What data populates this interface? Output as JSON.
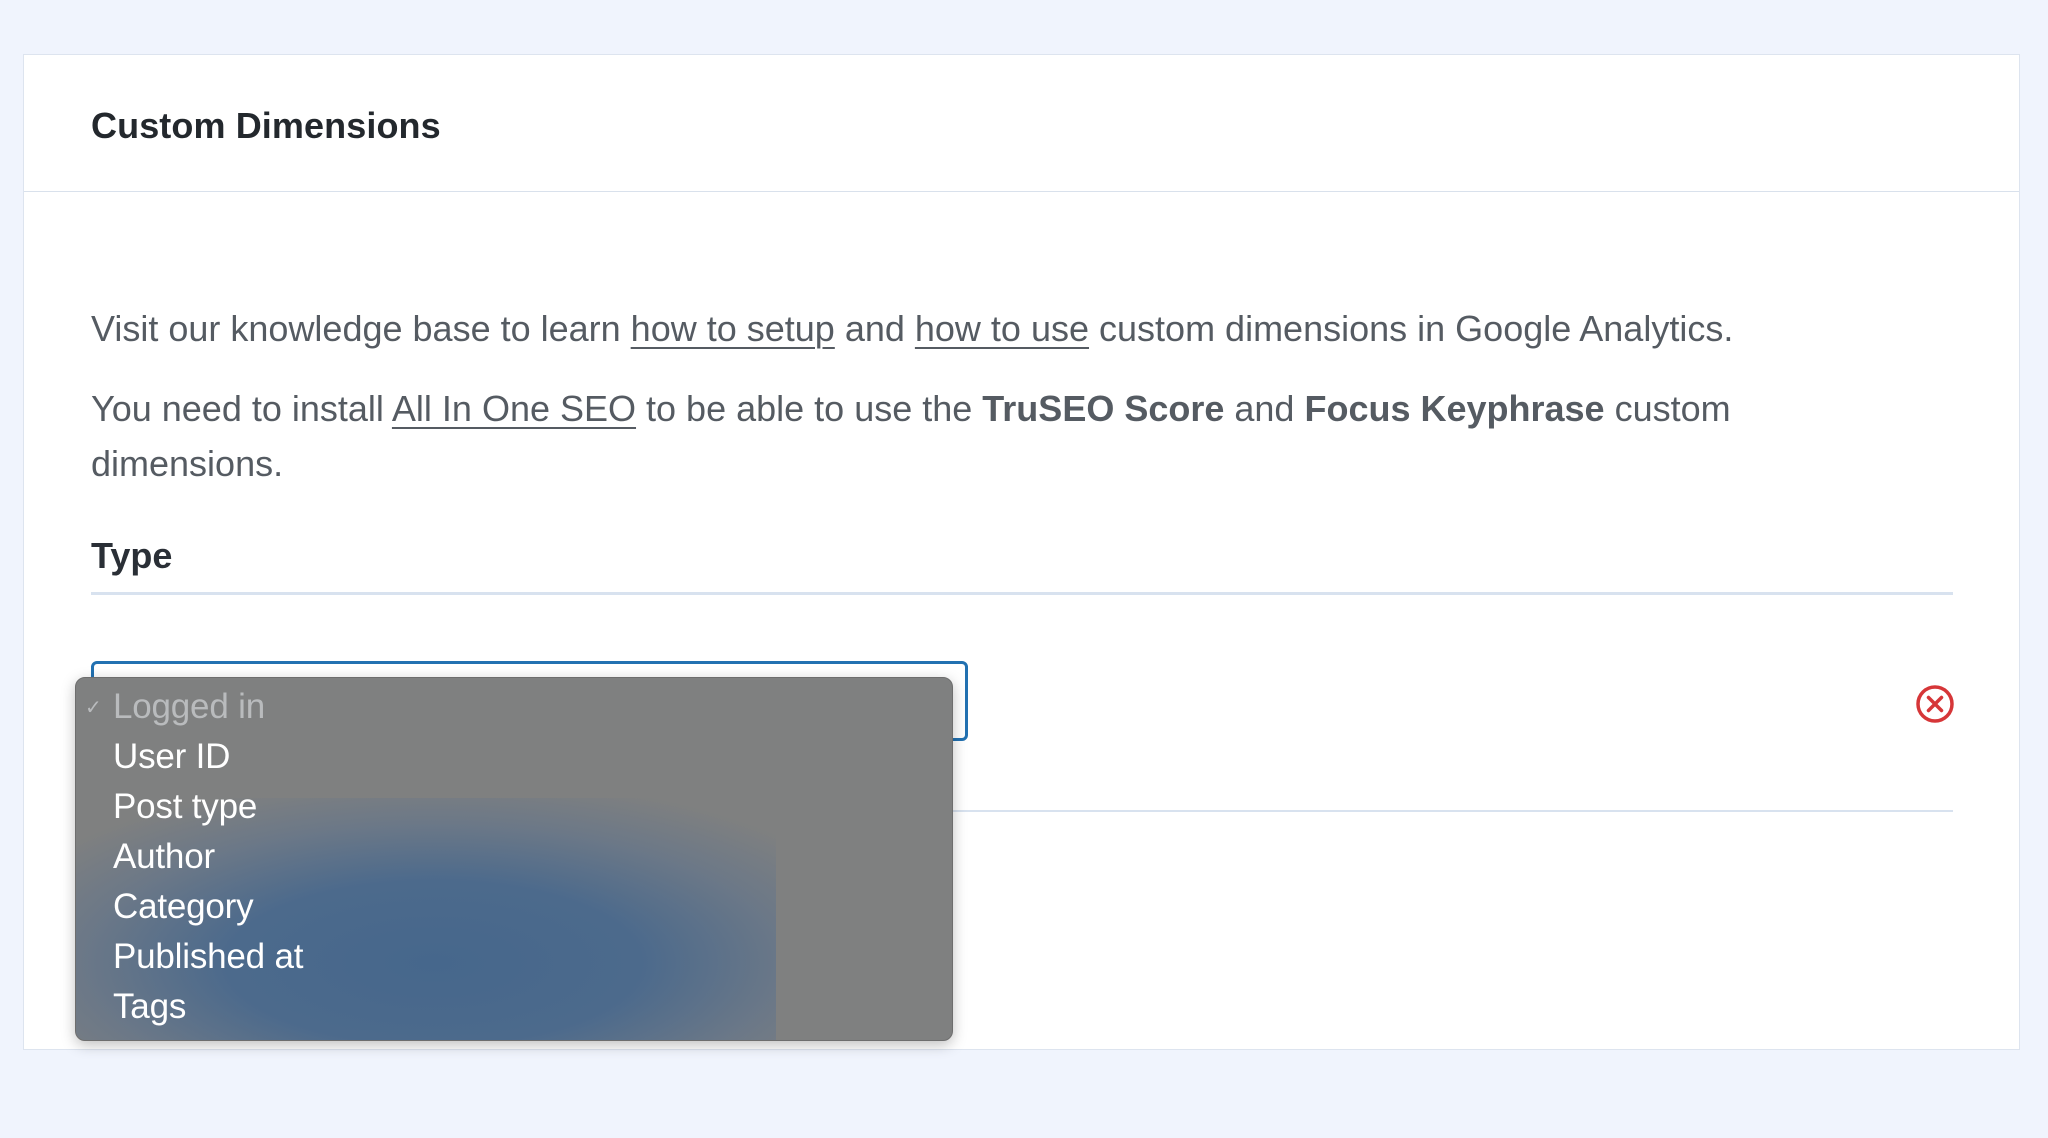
{
  "panel": {
    "title": "Custom Dimensions"
  },
  "intro": {
    "p1_before": "Visit our knowledge base to learn ",
    "p1_link1": "how to setup",
    "p1_mid": " and ",
    "p1_link2": "how to use",
    "p1_after": " custom dimensions in Google Analytics.",
    "p2_before": "You need to install ",
    "p2_link": "All In One SEO",
    "p2_mid1": " to be able to use the ",
    "p2_bold1": "TruSEO Score",
    "p2_mid2": " and ",
    "p2_bold2": "Focus Keyphrase",
    "p2_after": " custom dimensions."
  },
  "type_label": "Type",
  "dropdown": {
    "selected": "Logged in",
    "options": [
      {
        "label": "Logged in",
        "disabled": true,
        "checked": true
      },
      {
        "label": "User ID"
      },
      {
        "label": "Post type"
      },
      {
        "label": "Author"
      },
      {
        "label": "Category"
      },
      {
        "label": "Published at"
      },
      {
        "label": "Tags"
      }
    ]
  },
  "icons": {
    "check": "checkmark-icon",
    "remove": "remove-circle-icon"
  },
  "colors": {
    "accent": "#2271b1",
    "remove": "#d63638",
    "background": "#f0f4fd"
  }
}
